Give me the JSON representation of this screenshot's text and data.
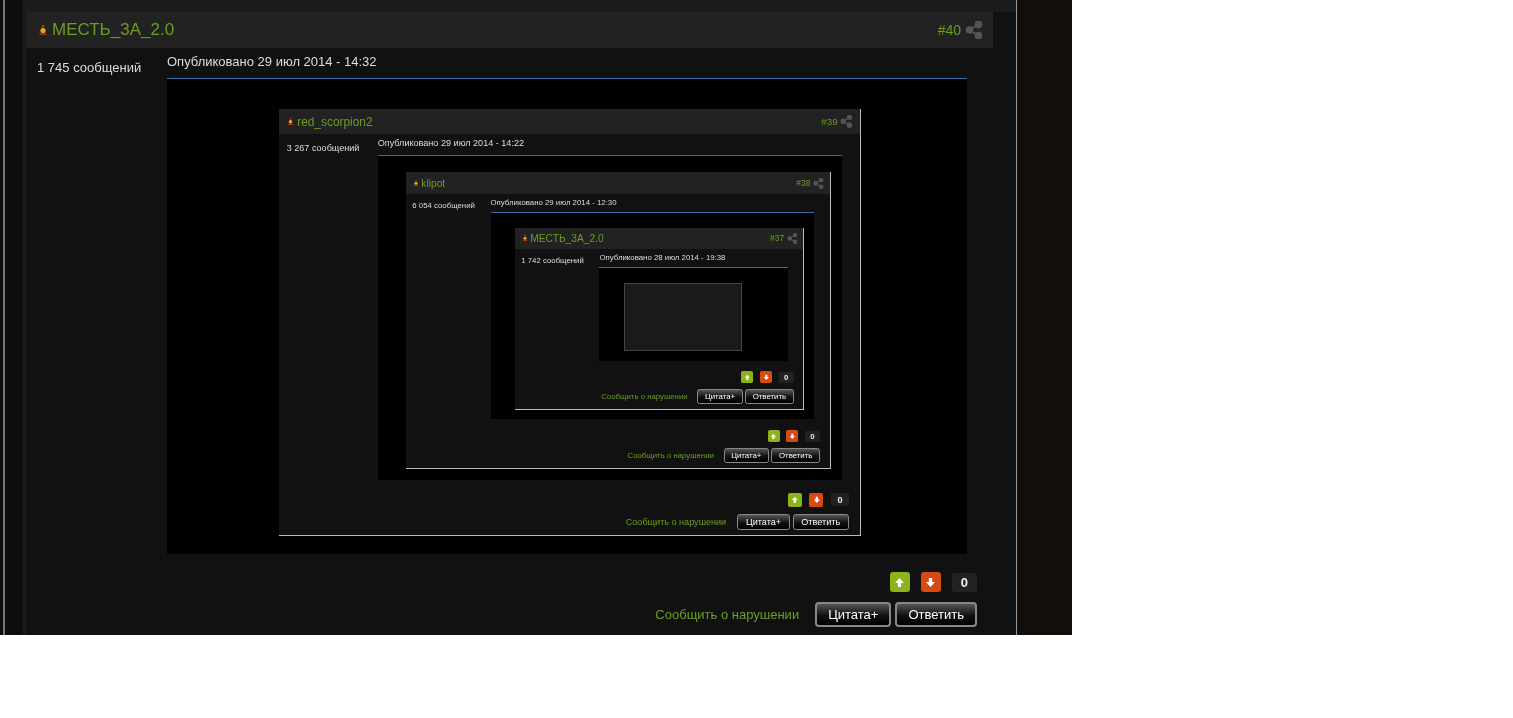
{
  "post": {
    "author": "МЕСТЬ_3А_2.0",
    "number": "#40",
    "message_count": "1 745 сообщений",
    "published": "Опубликовано 29 июл 2014 - 14:32",
    "attachment": {
      "kind": "screenshot",
      "post": {
        "author": "red_scorpion2",
        "number": "#39",
        "message_count": "3 267 сообщений",
        "published": "Опубликовано 29 июл 2014 - 14:22",
        "attachment": {
          "kind": "screenshot",
          "post": {
            "author": "klipot",
            "number": "#38",
            "message_count": "6 054 сообщений",
            "published": "Опубликовано 29 июл 2014 - 12:30",
            "attachment": {
              "kind": "screenshot",
              "post": {
                "author": "МЕСТЬ_3А_2.0",
                "number": "#37",
                "message_count": "1 742 сообщений",
                "published": "Опубликовано 28 июл 2014 - 19:38",
                "attachment": {
                  "kind": "placeholder"
                },
                "score": "0",
                "report": "Сообщить о нарушении",
                "quote": "Цитата+",
                "reply": "Ответить"
              }
            },
            "score": "0",
            "report": "Сообщить о нарушении",
            "quote": "Цитата+",
            "reply": "Ответить"
          }
        },
        "score": "0",
        "report": "Сообщить о нарушении",
        "quote": "Цитата+",
        "reply": "Ответить"
      }
    },
    "score": "0",
    "report": "Сообщить о нарушении",
    "quote": "Цитата+",
    "reply": "Ответить"
  }
}
